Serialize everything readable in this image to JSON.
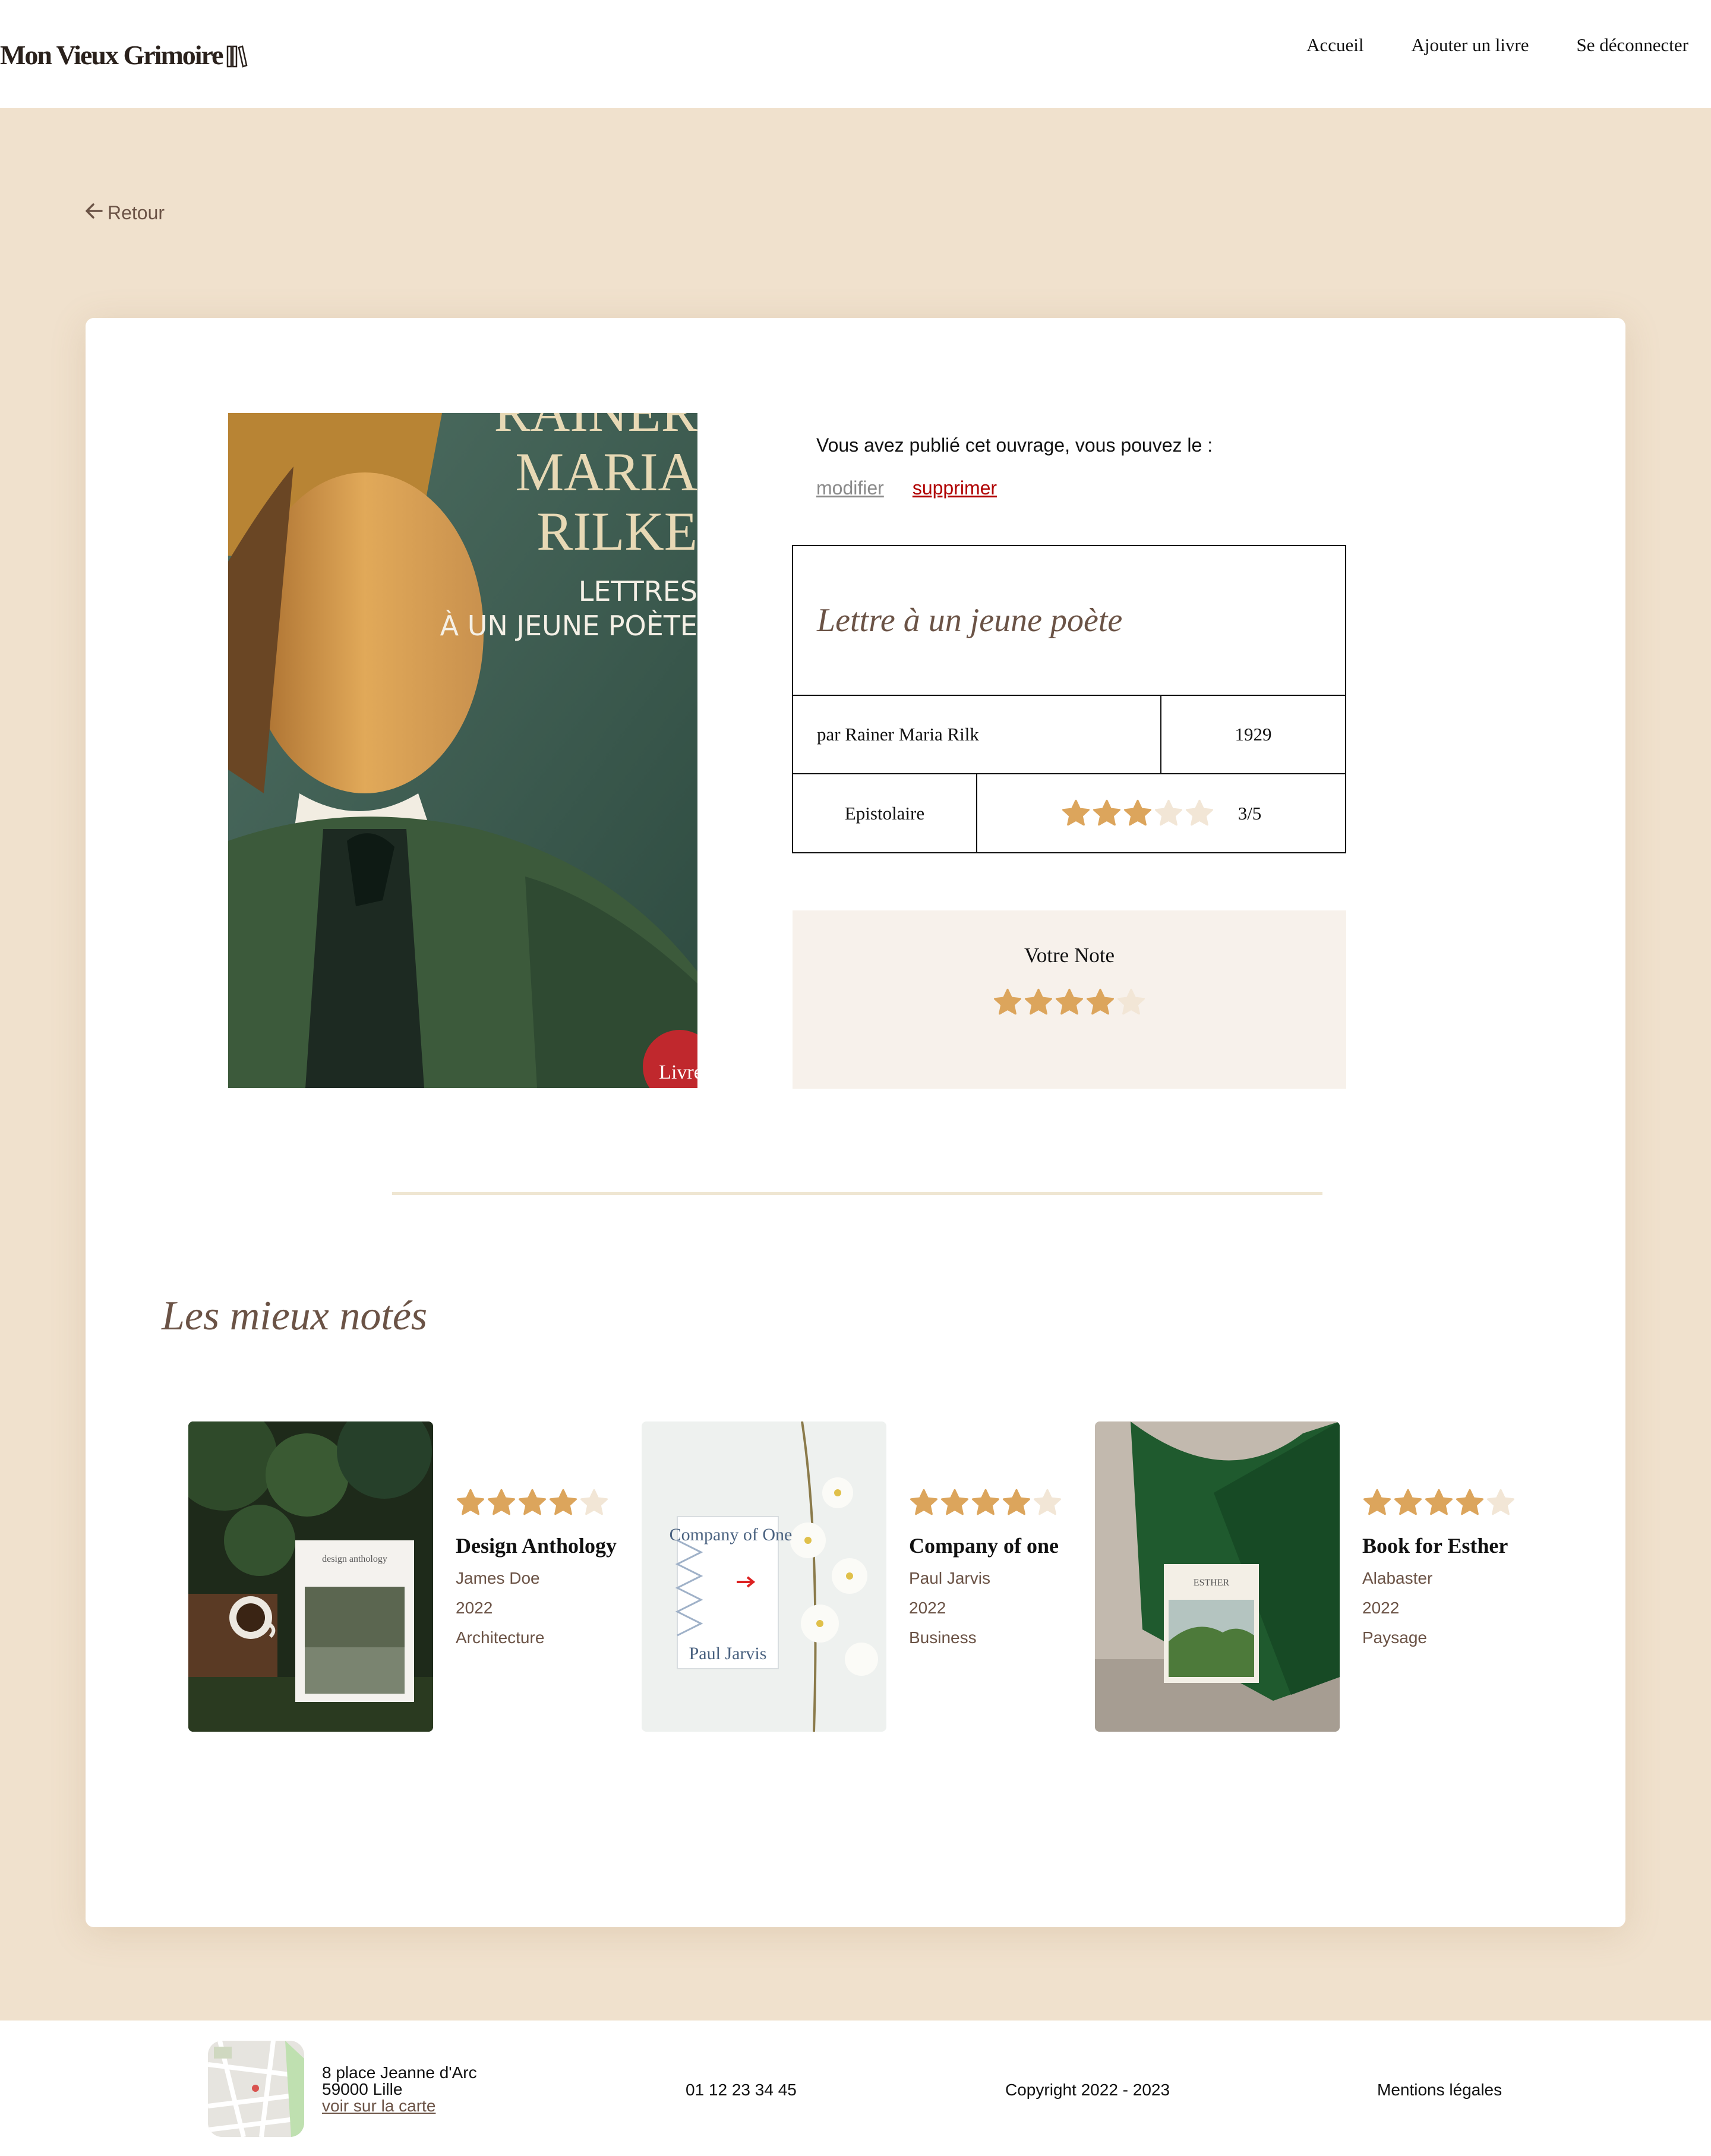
{
  "header": {
    "logo_text": "Mon Vieux Grimoire",
    "nav": {
      "home": "Accueil",
      "add_book": "Ajouter un livre",
      "logout": "Se déconnecter"
    }
  },
  "back_label": "Retour",
  "book": {
    "cover_lines": [
      "RAINER",
      "MARIA",
      "RILKE",
      "LETTRES",
      "À UN JEUNE POÈTE"
    ],
    "cover_badge": "Livre",
    "owner_notice": "Vous avez publié cet ouvrage, vous pouvez le :",
    "modify_label": "modifier",
    "delete_label": "supprimer",
    "title": "Lettre à un jeune poète",
    "author": "par Rainer Maria Rilk",
    "year": "1929",
    "genre": "Epistolaire",
    "rating": 3,
    "rating_max": 5,
    "rating_text": "3/5"
  },
  "your_note": {
    "label": "Votre Note",
    "rating": 4
  },
  "best_rated": {
    "title": "Les mieux notés",
    "items": [
      {
        "title": "Design Anthology",
        "author": "James Doe",
        "year": "2022",
        "genre": "Architecture",
        "rating": 4,
        "cover_text": "design anthology"
      },
      {
        "title": "Company of one",
        "author": "Paul Jarvis",
        "year": "2022",
        "genre": "Business",
        "rating": 4,
        "cover_text": "Company of One",
        "cover_author": "Paul Jarvis"
      },
      {
        "title": "Book for Esther",
        "author": "Alabaster",
        "year": "2022",
        "genre": "Paysage",
        "rating": 4,
        "cover_text": "ESTHER"
      }
    ]
  },
  "footer": {
    "address_line1": "8 place Jeanne d'Arc",
    "address_line2": "59000 Lille",
    "map_link": "voir sur la carte",
    "phone": "01 12 23 34 45",
    "copyright": "Copyright 2022 - 2023",
    "legal": "Mentions légales"
  },
  "colors": {
    "background": "#F0E1CD",
    "accent_brown": "#6B5346",
    "star_filled": "#DCA55C",
    "star_empty": "#F2E6D6",
    "delete_red": "#B00000"
  }
}
